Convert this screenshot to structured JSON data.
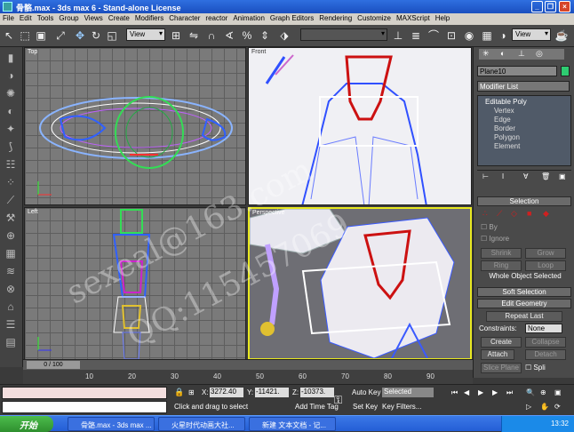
{
  "title": "骨骼.max - 3ds max 6 - Stand-alone License",
  "menu": [
    "File",
    "Edit",
    "Tools",
    "Group",
    "Views",
    "Create",
    "Modifiers",
    "Character",
    "reactor",
    "Animation",
    "Graph Editors",
    "Rendering",
    "Customize",
    "MAXScript",
    "Help"
  ],
  "toolbar": {
    "view_select_1": "View",
    "view_select_2": "View"
  },
  "viewports": {
    "top": "Top",
    "front": "Front",
    "left": "Left",
    "perspective": "Perspective"
  },
  "panel": {
    "object_name": "Plane10",
    "modifier_list": "Modifier List",
    "stack": [
      "Editable Poly",
      "Vertex",
      "Edge",
      "Border",
      "Polygon",
      "Element"
    ],
    "selection_rollout": "Selection",
    "by_vertex": "By",
    "ignore": "Ignore",
    "shrink": "Shrink",
    "grow": "Grow",
    "ring": "Ring",
    "loop": "Loop",
    "whole_object": "Whole Object Selected",
    "soft_selection": "Soft Selection",
    "edit_geometry": "Edit Geometry",
    "repeat_last": "Repeat Last",
    "constraints_label": "Constraints:",
    "constraints_value": "None",
    "create": "Create",
    "collapse": "Collapse",
    "attach": "Attach",
    "detach": "Detach",
    "slice_plane": "Slice Plane",
    "split": "Spli"
  },
  "timeline": {
    "frame": "0 / 100",
    "ticks": [
      "10",
      "20",
      "30",
      "40",
      "50",
      "60",
      "70",
      "80",
      "90"
    ]
  },
  "status": {
    "x_label": "X:",
    "x": "3272.40",
    "y_label": "Y:",
    "y": "-11421.",
    "z_label": "Z:",
    "z": "-10373.",
    "auto_key": "Auto Key",
    "set_key": "Set Key",
    "key_mode": "Selected",
    "key_filters": "Key Filters...",
    "prompt": "Click and drag to select",
    "add_time_tag": "Add Time Tag"
  },
  "taskbar": {
    "start": "开始",
    "tasks": [
      "骨骼.max - 3ds max ...",
      "火星时代动画大社...",
      "新建 文本文档 - 记..."
    ],
    "time": "13:32"
  },
  "watermark": {
    "line1": "sexeal@163.com",
    "line2": "QQ:115457069"
  },
  "colors": {
    "title": "#245ed6",
    "viewport_bg": "#7a7a7a",
    "accent_red": "#d02020"
  }
}
